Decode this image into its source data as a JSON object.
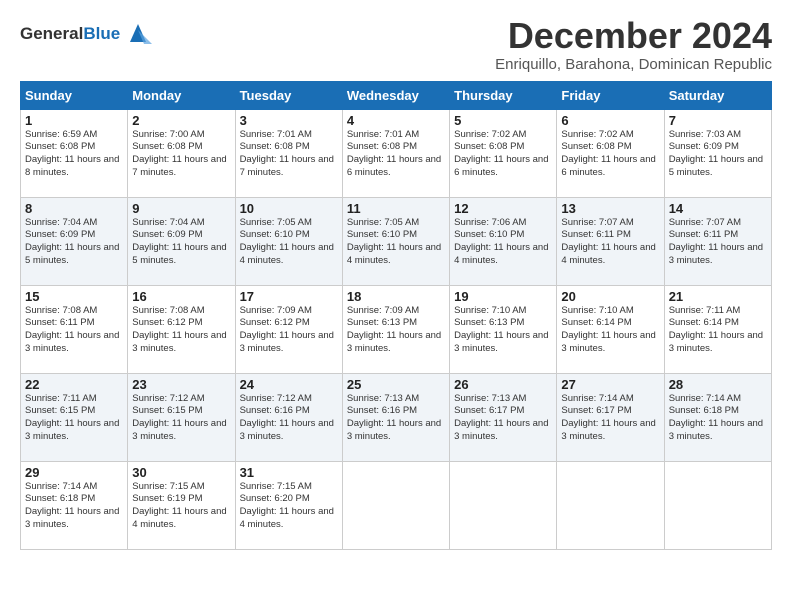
{
  "logo": {
    "line1": "General",
    "line2": "Blue"
  },
  "title": "December 2024",
  "subtitle": "Enriquillo, Barahona, Dominican Republic",
  "header": {
    "days": [
      "Sunday",
      "Monday",
      "Tuesday",
      "Wednesday",
      "Thursday",
      "Friday",
      "Saturday"
    ]
  },
  "weeks": [
    [
      {
        "day": "1",
        "sunrise": "6:59 AM",
        "sunset": "6:08 PM",
        "daylight": "11 hours and 8 minutes."
      },
      {
        "day": "2",
        "sunrise": "7:00 AM",
        "sunset": "6:08 PM",
        "daylight": "11 hours and 7 minutes."
      },
      {
        "day": "3",
        "sunrise": "7:01 AM",
        "sunset": "6:08 PM",
        "daylight": "11 hours and 7 minutes."
      },
      {
        "day": "4",
        "sunrise": "7:01 AM",
        "sunset": "6:08 PM",
        "daylight": "11 hours and 6 minutes."
      },
      {
        "day": "5",
        "sunrise": "7:02 AM",
        "sunset": "6:08 PM",
        "daylight": "11 hours and 6 minutes."
      },
      {
        "day": "6",
        "sunrise": "7:02 AM",
        "sunset": "6:08 PM",
        "daylight": "11 hours and 6 minutes."
      },
      {
        "day": "7",
        "sunrise": "7:03 AM",
        "sunset": "6:09 PM",
        "daylight": "11 hours and 5 minutes."
      }
    ],
    [
      {
        "day": "8",
        "sunrise": "7:04 AM",
        "sunset": "6:09 PM",
        "daylight": "11 hours and 5 minutes."
      },
      {
        "day": "9",
        "sunrise": "7:04 AM",
        "sunset": "6:09 PM",
        "daylight": "11 hours and 5 minutes."
      },
      {
        "day": "10",
        "sunrise": "7:05 AM",
        "sunset": "6:10 PM",
        "daylight": "11 hours and 4 minutes."
      },
      {
        "day": "11",
        "sunrise": "7:05 AM",
        "sunset": "6:10 PM",
        "daylight": "11 hours and 4 minutes."
      },
      {
        "day": "12",
        "sunrise": "7:06 AM",
        "sunset": "6:10 PM",
        "daylight": "11 hours and 4 minutes."
      },
      {
        "day": "13",
        "sunrise": "7:07 AM",
        "sunset": "6:11 PM",
        "daylight": "11 hours and 4 minutes."
      },
      {
        "day": "14",
        "sunrise": "7:07 AM",
        "sunset": "6:11 PM",
        "daylight": "11 hours and 3 minutes."
      }
    ],
    [
      {
        "day": "15",
        "sunrise": "7:08 AM",
        "sunset": "6:11 PM",
        "daylight": "11 hours and 3 minutes."
      },
      {
        "day": "16",
        "sunrise": "7:08 AM",
        "sunset": "6:12 PM",
        "daylight": "11 hours and 3 minutes."
      },
      {
        "day": "17",
        "sunrise": "7:09 AM",
        "sunset": "6:12 PM",
        "daylight": "11 hours and 3 minutes."
      },
      {
        "day": "18",
        "sunrise": "7:09 AM",
        "sunset": "6:13 PM",
        "daylight": "11 hours and 3 minutes."
      },
      {
        "day": "19",
        "sunrise": "7:10 AM",
        "sunset": "6:13 PM",
        "daylight": "11 hours and 3 minutes."
      },
      {
        "day": "20",
        "sunrise": "7:10 AM",
        "sunset": "6:14 PM",
        "daylight": "11 hours and 3 minutes."
      },
      {
        "day": "21",
        "sunrise": "7:11 AM",
        "sunset": "6:14 PM",
        "daylight": "11 hours and 3 minutes."
      }
    ],
    [
      {
        "day": "22",
        "sunrise": "7:11 AM",
        "sunset": "6:15 PM",
        "daylight": "11 hours and 3 minutes."
      },
      {
        "day": "23",
        "sunrise": "7:12 AM",
        "sunset": "6:15 PM",
        "daylight": "11 hours and 3 minutes."
      },
      {
        "day": "24",
        "sunrise": "7:12 AM",
        "sunset": "6:16 PM",
        "daylight": "11 hours and 3 minutes."
      },
      {
        "day": "25",
        "sunrise": "7:13 AM",
        "sunset": "6:16 PM",
        "daylight": "11 hours and 3 minutes."
      },
      {
        "day": "26",
        "sunrise": "7:13 AM",
        "sunset": "6:17 PM",
        "daylight": "11 hours and 3 minutes."
      },
      {
        "day": "27",
        "sunrise": "7:14 AM",
        "sunset": "6:17 PM",
        "daylight": "11 hours and 3 minutes."
      },
      {
        "day": "28",
        "sunrise": "7:14 AM",
        "sunset": "6:18 PM",
        "daylight": "11 hours and 3 minutes."
      }
    ],
    [
      {
        "day": "29",
        "sunrise": "7:14 AM",
        "sunset": "6:18 PM",
        "daylight": "11 hours and 3 minutes."
      },
      {
        "day": "30",
        "sunrise": "7:15 AM",
        "sunset": "6:19 PM",
        "daylight": "11 hours and 4 minutes."
      },
      {
        "day": "31",
        "sunrise": "7:15 AM",
        "sunset": "6:20 PM",
        "daylight": "11 hours and 4 minutes."
      },
      null,
      null,
      null,
      null
    ]
  ],
  "labels": {
    "sunrise": "Sunrise:",
    "sunset": "Sunset:",
    "daylight": "Daylight hours"
  }
}
